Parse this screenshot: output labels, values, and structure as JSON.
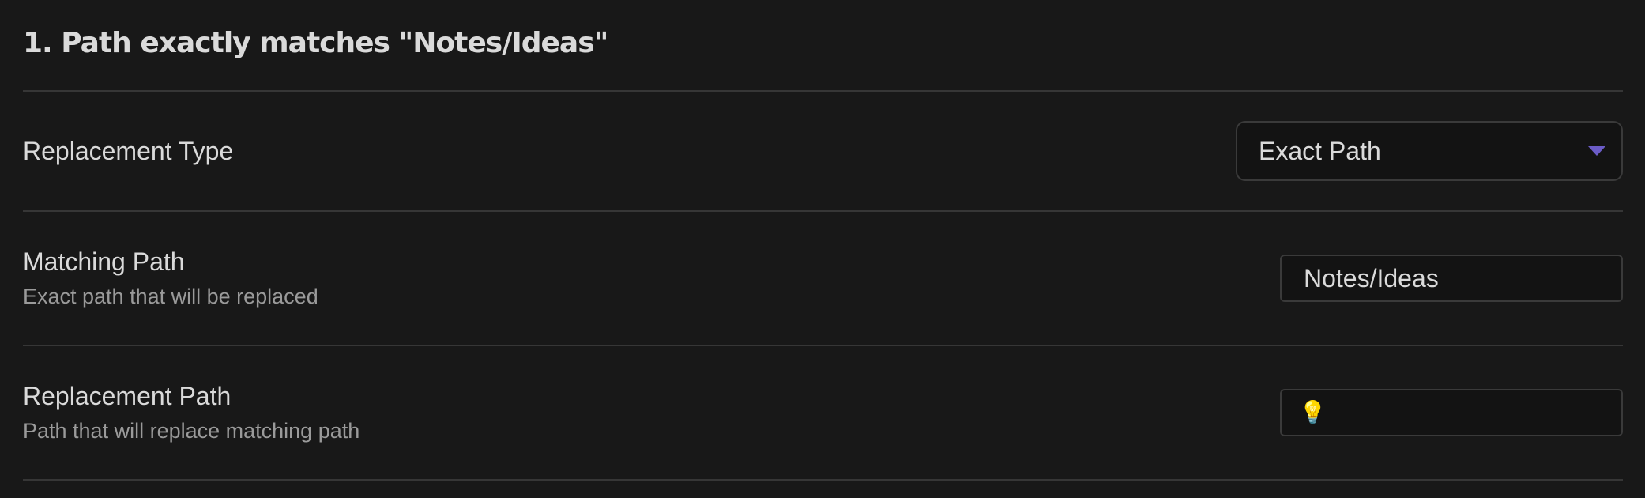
{
  "section": {
    "title": "1. Path exactly matches \"Notes/Ideas\""
  },
  "settings": [
    {
      "label": "Replacement Type",
      "control": "dropdown",
      "value": "Exact Path"
    },
    {
      "label": "Matching Path",
      "description": "Exact path that will be replaced",
      "control": "text",
      "value": "Notes/Ideas"
    },
    {
      "label": "Replacement Path",
      "description": "Path that will replace matching path",
      "control": "text",
      "value": "",
      "icon": "lightbulb-icon"
    }
  ],
  "colors": {
    "background": "#181818",
    "input_background": "#131313",
    "border": "#363636",
    "accent": "#6b5cc7",
    "text": "#dadada",
    "muted_text": "#9a9a9a"
  }
}
